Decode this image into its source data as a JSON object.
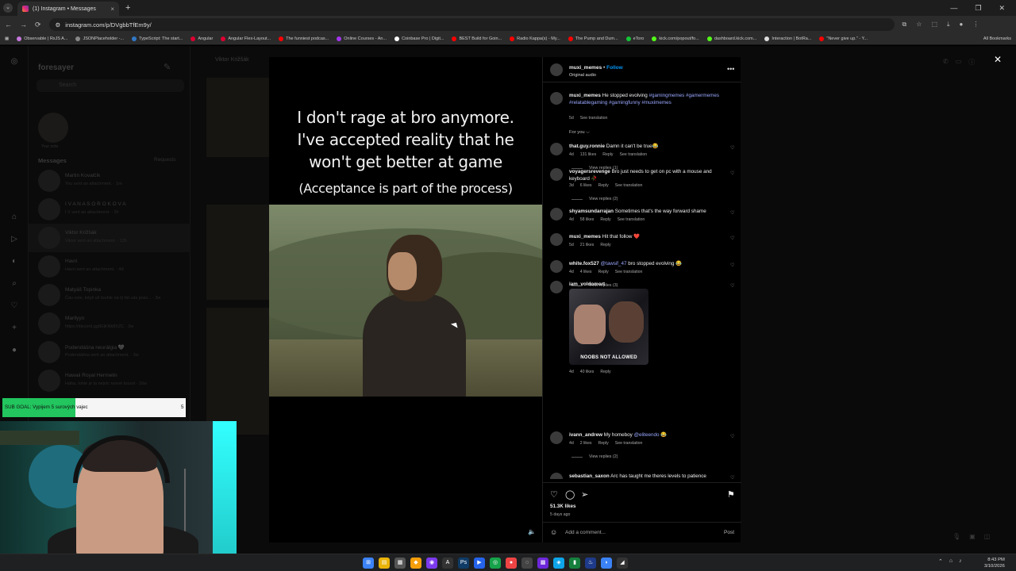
{
  "browser": {
    "tab_title": "(1) Instagram • Messages",
    "new_tab": "+",
    "tab_close": "×",
    "url": "instagram.com/p/DVgbbTfEm9y/",
    "window_controls": [
      "—",
      "❐",
      "✕"
    ],
    "bookmarks": [
      {
        "label": "Observable | RxJS A...",
        "color": "#c678dd"
      },
      {
        "label": "JSONPlaceholder -...",
        "color": "#888888"
      },
      {
        "label": "TypeScript: The start...",
        "color": "#3178c6"
      },
      {
        "label": "Angular",
        "color": "#dd0031"
      },
      {
        "label": "Angular Flex-Layout...",
        "color": "#dd0031"
      },
      {
        "label": "The funniest podcas...",
        "color": "#ff0000"
      },
      {
        "label": "Online Courses - An...",
        "color": "#a435f0"
      },
      {
        "label": "Coinbase Pro | Digit...",
        "color": "#ffffff"
      },
      {
        "label": "BEST Build for Goin...",
        "color": "#ff0000"
      },
      {
        "label": "Radio Kappa(s) - My...",
        "color": "#ff0000"
      },
      {
        "label": "The Pump and Dum...",
        "color": "#ff0000"
      },
      {
        "label": "eToro",
        "color": "#13c636"
      },
      {
        "label": "kick.com/popout/fo...",
        "color": "#53fc18"
      },
      {
        "label": "dashboard.kick.com...",
        "color": "#53fc18"
      },
      {
        "label": "Interaction | BotRa...",
        "color": "#dddddd"
      },
      {
        "label": "\"Never give up.\" - Y...",
        "color": "#ff0000"
      }
    ],
    "all_bookmarks": "All Bookmarks"
  },
  "messages": {
    "username": "foresayer",
    "search_placeholder": "Search",
    "note_label": "Your note",
    "heading": "Messages",
    "requests": "Requests",
    "conversations": [
      {
        "name": "Martin Kovalčík",
        "preview": "You sent an attachment. · 1m"
      },
      {
        "name": "I V A N A S O R O K O V A",
        "preview": "I V sent an attachment. · 2h"
      },
      {
        "name": "Viktor Križšák",
        "preview": "Viktor sent an attachment. · 12h"
      },
      {
        "name": "Havri",
        "preview": "Havri sent an attachment. · 4d"
      },
      {
        "name": "Matyáš Topinka",
        "preview": "Čau vole, když už touhle na tý fat vás pozv... · 3w"
      },
      {
        "name": "Marllyyn",
        "preview": "https://discord.gg/EIjKNk8XZC · 3w"
      },
      {
        "name": "Podendášna neurálgia 🖤",
        "preview": "Podendášna sent an attachment. · 3w"
      },
      {
        "name": "Hawaii Royal Hermelin",
        "preview": "Haha, tohle je ta nejvíc novvé tossol · 16w"
      }
    ],
    "chat_header": "Viktor Križšák"
  },
  "post": {
    "caption_main": "I don't rage at bro anymore. I've accepted reality that he won't get better at game",
    "caption_sub": "(Acceptance is part of the process)",
    "author": "muxi_memes",
    "follow": "Follow",
    "audio": "Original audio",
    "more": "•••",
    "description": {
      "user": "muxi_memes",
      "text": "He stopped evolving",
      "tags": "#gamingmemes #gamermemes #relatablegaming #gamingfunny #muximemes",
      "time": "5d",
      "translate": "See translation"
    },
    "for_you": "For you ⌵",
    "comments": [
      {
        "user": "that.guy.ronnie",
        "text": "Damn it can't be true😂",
        "time": "4d",
        "likes": "131 likes",
        "reply": "Reply",
        "translate": "See translation",
        "view_replies": "View replies (1)"
      },
      {
        "user": "voyagersrevenge",
        "text": "Bro just needs to get on pc with a mouse and keyboard 🥀",
        "time": "3d",
        "likes": "6 likes",
        "reply": "Reply",
        "translate": "See translation",
        "view_replies": "View replies (2)"
      },
      {
        "user": "shyamsundarrajan",
        "text": "Sometimes that's the way forward shame",
        "time": "4d",
        "likes": "58 likes",
        "reply": "Reply",
        "translate": "See translation",
        "view_replies": ""
      },
      {
        "user": "muxi_memes",
        "text": "Hit that follow ❤️",
        "time": "5d",
        "likes": "21 likes",
        "reply": "Reply",
        "translate": "",
        "view_replies": ""
      },
      {
        "user": "white.fox527",
        "mention": "@tawsif_47",
        "text": "bro stopped evolving 😂",
        "time": "4d",
        "likes": "4 likes",
        "reply": "Reply",
        "translate": "See translation",
        "view_replies": "View replies (3)"
      },
      {
        "user": "iam_voldomort",
        "text": "",
        "gif_text": "NOOBS NOT ALLOWED",
        "time": "4d",
        "likes": "40 likes",
        "reply": "Reply",
        "translate": "",
        "view_replies": ""
      },
      {
        "user": "ivann_andrew",
        "text": "My homeboy",
        "mention": "@eliteendo",
        "emoji": "😂",
        "time": "4d",
        "likes": "2 likes",
        "reply": "Reply",
        "translate": "See translation",
        "view_replies": "View replies (2)"
      },
      {
        "user": "sebastian_saxon",
        "text": "Arc has taught me theres levels to patience",
        "time": "",
        "likes": "",
        "reply": "",
        "translate": "",
        "view_replies": ""
      }
    ],
    "likes_count": "51.3K likes",
    "posted_ago": "5 days ago",
    "add_comment_placeholder": "Add a comment...",
    "post_button": "Post"
  },
  "overlay": {
    "sub_goal": "SUB GOAL: Vypijem 5 surových vajec",
    "sub_count": "5",
    "sub_progress": 0.4
  },
  "taskbar": {
    "time": "8:43 PM",
    "date": "3/10/2026"
  },
  "colors": {
    "instagram_blue": "#0095f6",
    "hashtag": "#9aa8ff",
    "goal_fill": "#22c55e"
  }
}
